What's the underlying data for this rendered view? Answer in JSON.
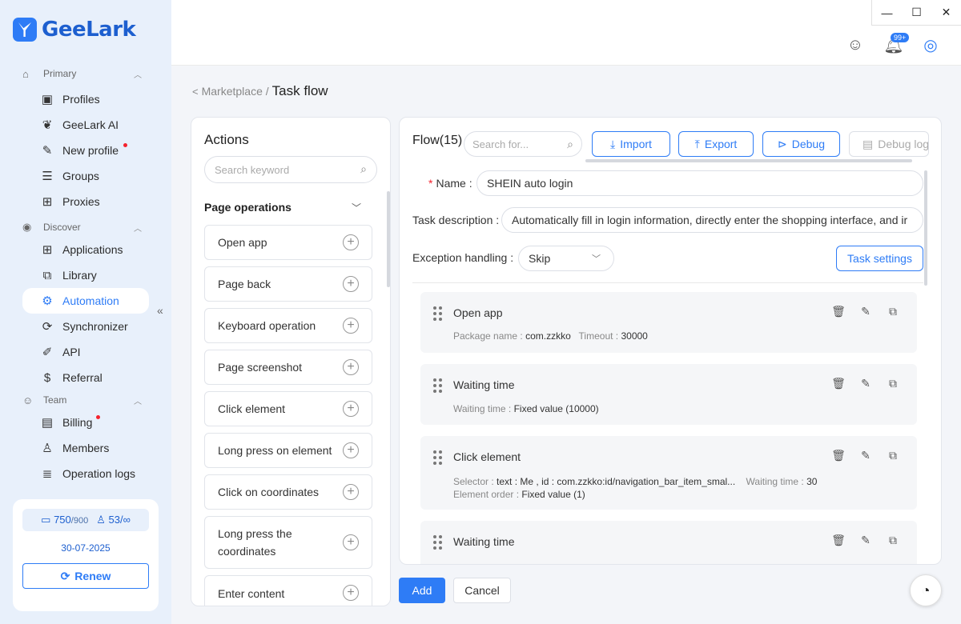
{
  "app": {
    "logo_text": "GeeLark"
  },
  "window": {
    "minimize": "—",
    "maximize": "☐",
    "close": "✕"
  },
  "topbar": {
    "notification_badge": "99+"
  },
  "sidebar": {
    "sections": [
      {
        "label": "Primary",
        "icon": "home-icon"
      },
      {
        "label": "Discover",
        "icon": "eye-icon"
      },
      {
        "label": "Team",
        "icon": "team-icon"
      }
    ],
    "primary_items": [
      {
        "label": "Profiles",
        "icon": "profiles-icon"
      },
      {
        "label": "GeeLark AI",
        "icon": "ai-icon"
      },
      {
        "label": "New profile",
        "icon": "edit-icon",
        "dot": true
      },
      {
        "label": "Groups",
        "icon": "list-icon"
      },
      {
        "label": "Proxies",
        "icon": "proxies-icon"
      }
    ],
    "discover_items": [
      {
        "label": "Applications",
        "icon": "apps-icon"
      },
      {
        "label": "Library",
        "icon": "library-icon"
      },
      {
        "label": "Automation",
        "icon": "robot-icon",
        "active": true
      },
      {
        "label": "Synchronizer",
        "icon": "sync-icon"
      },
      {
        "label": "API",
        "icon": "api-icon"
      },
      {
        "label": "Referral",
        "icon": "dollar-icon"
      }
    ],
    "team_items": [
      {
        "label": "Billing",
        "icon": "wallet-icon",
        "dot": true
      },
      {
        "label": "Members",
        "icon": "user-icon"
      },
      {
        "label": "Operation logs",
        "icon": "logs-icon"
      }
    ],
    "plan": {
      "profiles_used": "750",
      "profiles_total": "/900",
      "members_used": "53/",
      "members_total": "∞",
      "expiry": "30-07-2025",
      "renew_label": "Renew"
    }
  },
  "breadcrumb": {
    "back": "<",
    "parent": "Marketplace /",
    "current": "Task flow"
  },
  "actions": {
    "title": "Actions",
    "search_placeholder": "Search keyword",
    "group_label": "Page operations",
    "items": [
      "Open app",
      "Page back",
      "Keyboard operation",
      "Page screenshot",
      "Click element",
      "Long press on element",
      "Click on coordinates",
      "Long press the coordinates",
      "Enter content"
    ]
  },
  "flow": {
    "title": "Flow(15)",
    "search_placeholder": "Search for...",
    "import_label": "Import",
    "export_label": "Export",
    "debug_label": "Debug",
    "debug_log_label": "Debug log",
    "name_label": "Name :",
    "name_value": "SHEIN auto login",
    "desc_label": "Task description :",
    "desc_value": "Automatically fill in login information, directly enter the shopping interface, and ir",
    "exception_label": "Exception handling :",
    "exception_value": "Skip",
    "task_settings_label": "Task settings",
    "steps": [
      {
        "title": "Open app",
        "line1": [
          {
            "k": "Package name :",
            "v": "com.zzkko"
          },
          {
            "k": "Timeout :",
            "v": "30000"
          }
        ]
      },
      {
        "title": "Waiting time",
        "line1": [
          {
            "k": "Waiting time :",
            "v": "Fixed value (10000)"
          }
        ]
      },
      {
        "title": "Click element",
        "line1": [
          {
            "k": "Selector :",
            "v": "text : Me , id : com.zzkko:id/navigation_bar_item_smal..."
          },
          {
            "k": "Waiting time :",
            "v": "30"
          }
        ],
        "line2": [
          {
            "k": "Element order :",
            "v": "Fixed value (1)"
          }
        ]
      },
      {
        "title": "Waiting time",
        "line1": []
      }
    ]
  },
  "footer": {
    "add_label": "Add",
    "cancel_label": "Cancel"
  }
}
